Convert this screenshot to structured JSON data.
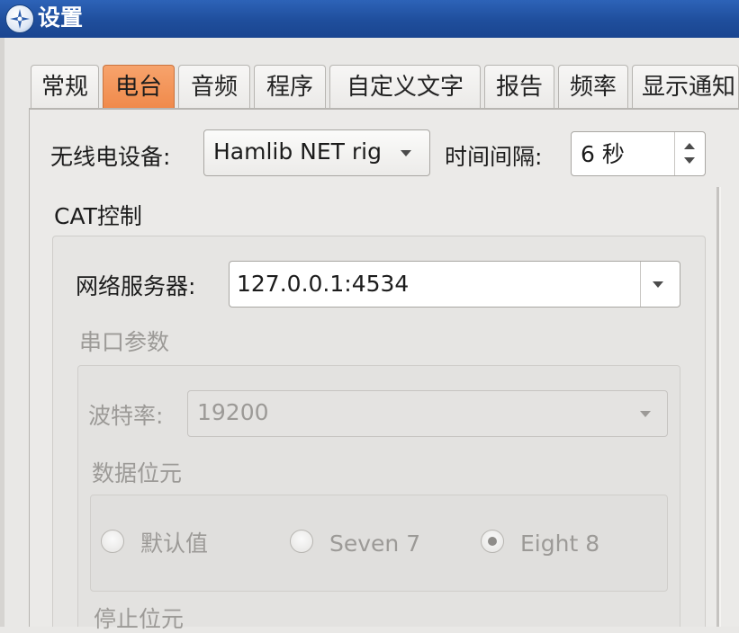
{
  "window": {
    "title": "设置",
    "icon": "compass-icon"
  },
  "tabs": [
    {
      "label": "常规",
      "active": false
    },
    {
      "label": "电台",
      "active": true
    },
    {
      "label": "音频",
      "active": false
    },
    {
      "label": "程序",
      "active": false
    },
    {
      "label": "自定义文字",
      "active": false
    },
    {
      "label": "报告",
      "active": false
    },
    {
      "label": "频率",
      "active": false
    },
    {
      "label": "显示通知",
      "active": false
    }
  ],
  "radio_device": {
    "label": "无线电设备:",
    "value": "Hamlib NET rig"
  },
  "interval": {
    "label": "时间间隔:",
    "value": "6 秒"
  },
  "cat": {
    "title": "CAT控制",
    "network_server": {
      "label": "网络服务器:",
      "value": "127.0.0.1:4534"
    },
    "serial": {
      "title": "串口参数",
      "baud": {
        "label": "波特率:",
        "value": "19200"
      },
      "data_bits": {
        "title": "数据位元",
        "options": [
          {
            "label": "默认值",
            "checked": false
          },
          {
            "label": "Seven 7",
            "checked": false
          },
          {
            "label": "Eight 8",
            "checked": true
          }
        ]
      },
      "stop_bits_title": "停止位元"
    }
  },
  "colors": {
    "active_tab": "#f08a4b",
    "titlebar": "#1f4e9c"
  }
}
